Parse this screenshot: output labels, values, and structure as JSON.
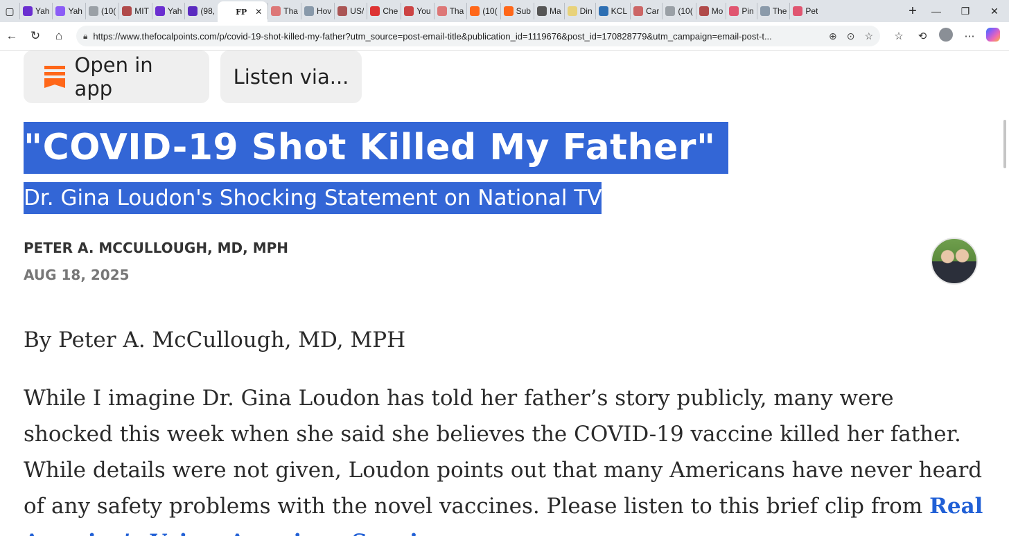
{
  "browser": {
    "tabs": [
      {
        "label": "Yah",
        "color": "#6b2fd0",
        "icon": "yahoo-icon"
      },
      {
        "label": "Yah",
        "color": "#8b5cf6",
        "icon": "yahoo-icon"
      },
      {
        "label": "(10(",
        "color": "#9aa0a6",
        "icon": "fp-icon"
      },
      {
        "label": "MIT",
        "color": "#b04a4a",
        "icon": "mail-icon"
      },
      {
        "label": "Yah",
        "color": "#6b2fd0",
        "icon": "yahoo-icon"
      },
      {
        "label": "(98,",
        "color": "#5b2bc0",
        "icon": "envelope-icon"
      },
      {
        "label": "FP",
        "color": "#111111",
        "icon": "fp-icon",
        "active": true
      },
      {
        "label": "Tha",
        "color": "#d77",
        "icon": "site-icon"
      },
      {
        "label": "Hov",
        "color": "#8899aa",
        "icon": "site-icon"
      },
      {
        "label": "US/",
        "color": "#a55",
        "icon": "site-icon"
      },
      {
        "label": "Che",
        "color": "#d33",
        "icon": "shield-icon"
      },
      {
        "label": "You",
        "color": "#c44",
        "icon": "site-icon"
      },
      {
        "label": "Tha",
        "color": "#d77",
        "icon": "site-icon"
      },
      {
        "label": "(10(",
        "color": "#ff6719",
        "icon": "substack-icon"
      },
      {
        "label": "Sub",
        "color": "#ff6719",
        "icon": "substack-icon"
      },
      {
        "label": "Ma",
        "color": "#555",
        "icon": "nyt-icon"
      },
      {
        "label": "Din",
        "color": "#e8d27a",
        "icon": "site-icon"
      },
      {
        "label": "KCL",
        "color": "#2d6fb3",
        "icon": "wordpress-icon"
      },
      {
        "label": "Car",
        "color": "#c66",
        "icon": "site-icon"
      },
      {
        "label": "(10(",
        "color": "#9aa0a6",
        "icon": "fp-icon"
      },
      {
        "label": "Mo",
        "color": "#b04a4a",
        "icon": "mail-icon"
      },
      {
        "label": "Pin",
        "color": "#e05570",
        "icon": "video-icon"
      },
      {
        "label": "The",
        "color": "#8a9aaa",
        "icon": "gp-icon"
      },
      {
        "label": "Pet",
        "color": "#e05570",
        "icon": "video-icon"
      }
    ],
    "active_close": "✕",
    "url": "https://www.thefocalpoints.com/p/covid-19-shot-killed-my-father?utm_source=post-email-title&publication_id=1119676&post_id=170828779&utm_campaign=email-post-t..."
  },
  "page": {
    "open_in_app": "Open in app",
    "listen_via": "Listen via...",
    "title": "\"COVID-19 Shot Killed My Father\"",
    "subtitle": "Dr. Gina Loudon's Shocking Statement on National TV",
    "author": "PETER A. MCCULLOUGH, MD, MPH",
    "date": "AUG 18, 2025",
    "byline": "By Peter A. McCullough, MD, MPH",
    "paragraph": "While I imagine Dr. Gina Loudon has told her father’s story publicly, many were shocked this week when she said she believes the COVID-19 vaccine killed her father. While details were not given, Loudon points out that many Americans have never heard of any safety problems with the novel vaccines. Please listen to this brief clip from ",
    "link_text": "Real America’s Voice, American Sunrise,",
    "accent_color": "#3366d6",
    "link_color": "#2160d6"
  }
}
